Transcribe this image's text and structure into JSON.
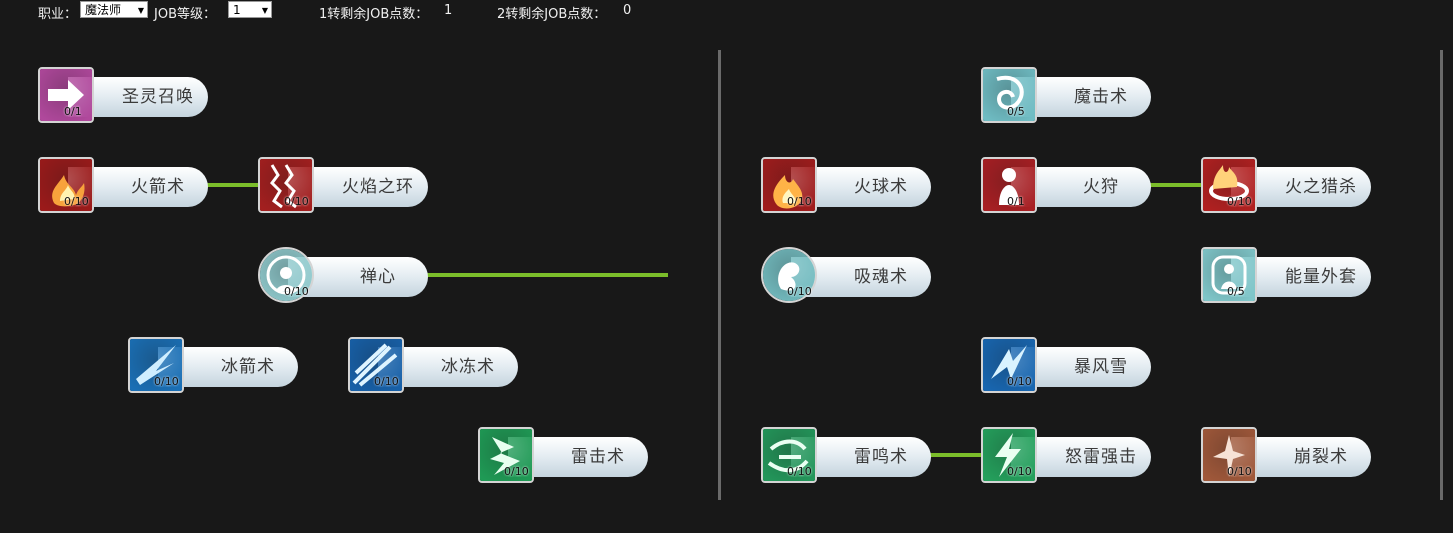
{
  "header": {
    "job_label": "职业：",
    "job_value": "魔法师",
    "level_label": "JOB等级：",
    "level_value": "1",
    "points1_label": "1转剩余JOB点数：",
    "points1_value": "1",
    "points2_label": "2转剩余JOB点数：",
    "points2_value": "0"
  },
  "skills": [
    {
      "id": "holy-spirit-summon",
      "name": "圣灵召唤",
      "points": "0/1",
      "icon": "arrow-icon",
      "color": "#b0489c"
    },
    {
      "id": "fire-arrow",
      "name": "火箭术",
      "points": "0/10",
      "icon": "flame-claw-icon",
      "color": "#9b1a1a"
    },
    {
      "id": "flame-ring",
      "name": "火焰之环",
      "points": "0/10",
      "icon": "flame-pillar-icon",
      "color": "#a31f1f"
    },
    {
      "id": "zen-mind",
      "name": "禅心",
      "points": "0/10",
      "icon": "aura-icon",
      "color": "#8fc9cc"
    },
    {
      "id": "ice-arrow",
      "name": "冰箭术",
      "points": "0/10",
      "icon": "ice-shard-icon",
      "color": "#1a6fb5"
    },
    {
      "id": "freeze",
      "name": "冰冻术",
      "points": "0/10",
      "icon": "ice-burst-icon",
      "color": "#1760a8"
    },
    {
      "id": "thunder-strike",
      "name": "雷击术",
      "points": "0/10",
      "icon": "lightning-icon",
      "color": "#1f9a55"
    },
    {
      "id": "magic-strike",
      "name": "魔击术",
      "points": "0/5",
      "icon": "vortex-icon",
      "color": "#6fbcc3"
    },
    {
      "id": "fireball",
      "name": "火球术",
      "points": "0/10",
      "icon": "fireball-icon",
      "color": "#a01c1c"
    },
    {
      "id": "fire-hunt",
      "name": "火狩",
      "points": "0/1",
      "icon": "fire-figure-icon",
      "color": "#a81f23"
    },
    {
      "id": "fire-slay",
      "name": "火之猎杀",
      "points": "0/10",
      "icon": "fire-circle-icon",
      "color": "#b12020"
    },
    {
      "id": "soul-drain",
      "name": "吸魂术",
      "points": "0/10",
      "icon": "spirit-icon",
      "color": "#73bcc0"
    },
    {
      "id": "energy-coat",
      "name": "能量外套",
      "points": "0/5",
      "icon": "shield-figure-icon",
      "color": "#7fc6c9"
    },
    {
      "id": "blizzard",
      "name": "暴风雪",
      "points": "0/10",
      "icon": "blizzard-icon",
      "color": "#1866b0"
    },
    {
      "id": "thunder-roar",
      "name": "雷鸣术",
      "points": "0/10",
      "icon": "thunder-dragon-icon",
      "color": "#23965a"
    },
    {
      "id": "raging-thunder",
      "name": "怒雷强击",
      "points": "0/10",
      "icon": "thunder-bolt-icon",
      "color": "#24a05c"
    },
    {
      "id": "collapse",
      "name": "崩裂术",
      "points": "0/10",
      "icon": "crack-icon",
      "color": "#a0583a"
    }
  ]
}
